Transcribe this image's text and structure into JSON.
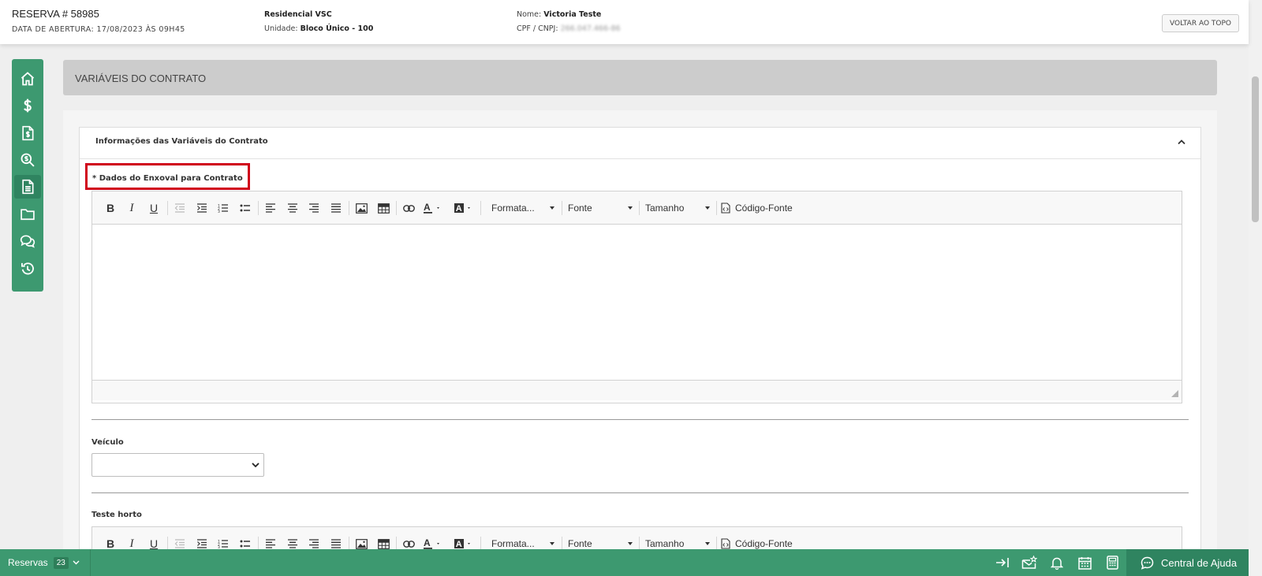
{
  "header": {
    "title": "RESERVA # 58985",
    "opening_date": "DATA DE ABERTURA: 17/08/2023 ÀS 09H45",
    "project": "Residencial VSC",
    "unit_label": "Unidade:",
    "unit_value": "Bloco Único - 100",
    "name_label": "Nome:",
    "name_value": "Victoria Teste",
    "doc_label": "CPF / CNPJ:",
    "doc_value": "266.047.466-86",
    "back_to_top": "VOLTAR AO TOPO"
  },
  "sidebar": {
    "icons": [
      "home-icon",
      "dollar-icon",
      "invoice-icon",
      "search-dollar-icon",
      "document-icon",
      "folder-icon",
      "chat-icon",
      "history-icon"
    ],
    "active_index": 4,
    "color": "#3d9970"
  },
  "section": {
    "title": "VARIÁVEIS DO CONTRATO"
  },
  "card": {
    "title": "Informações das Variáveis do Contrato",
    "field1_label": "* Dados do Enxoval para Contrato",
    "field2_label": "Veículo",
    "field2_value": "",
    "field3_label": "Teste horto"
  },
  "editor": {
    "format_label": "Formata...",
    "font_label": "Fonte",
    "size_label": "Tamanho",
    "source_label": "Código-Fonte"
  },
  "bottombar": {
    "reservas_label": "Reservas",
    "reservas_count": "23",
    "help_label": "Central de Ajuda"
  },
  "colors": {
    "accent": "#3d9970",
    "highlight_box": "#d0021b"
  }
}
